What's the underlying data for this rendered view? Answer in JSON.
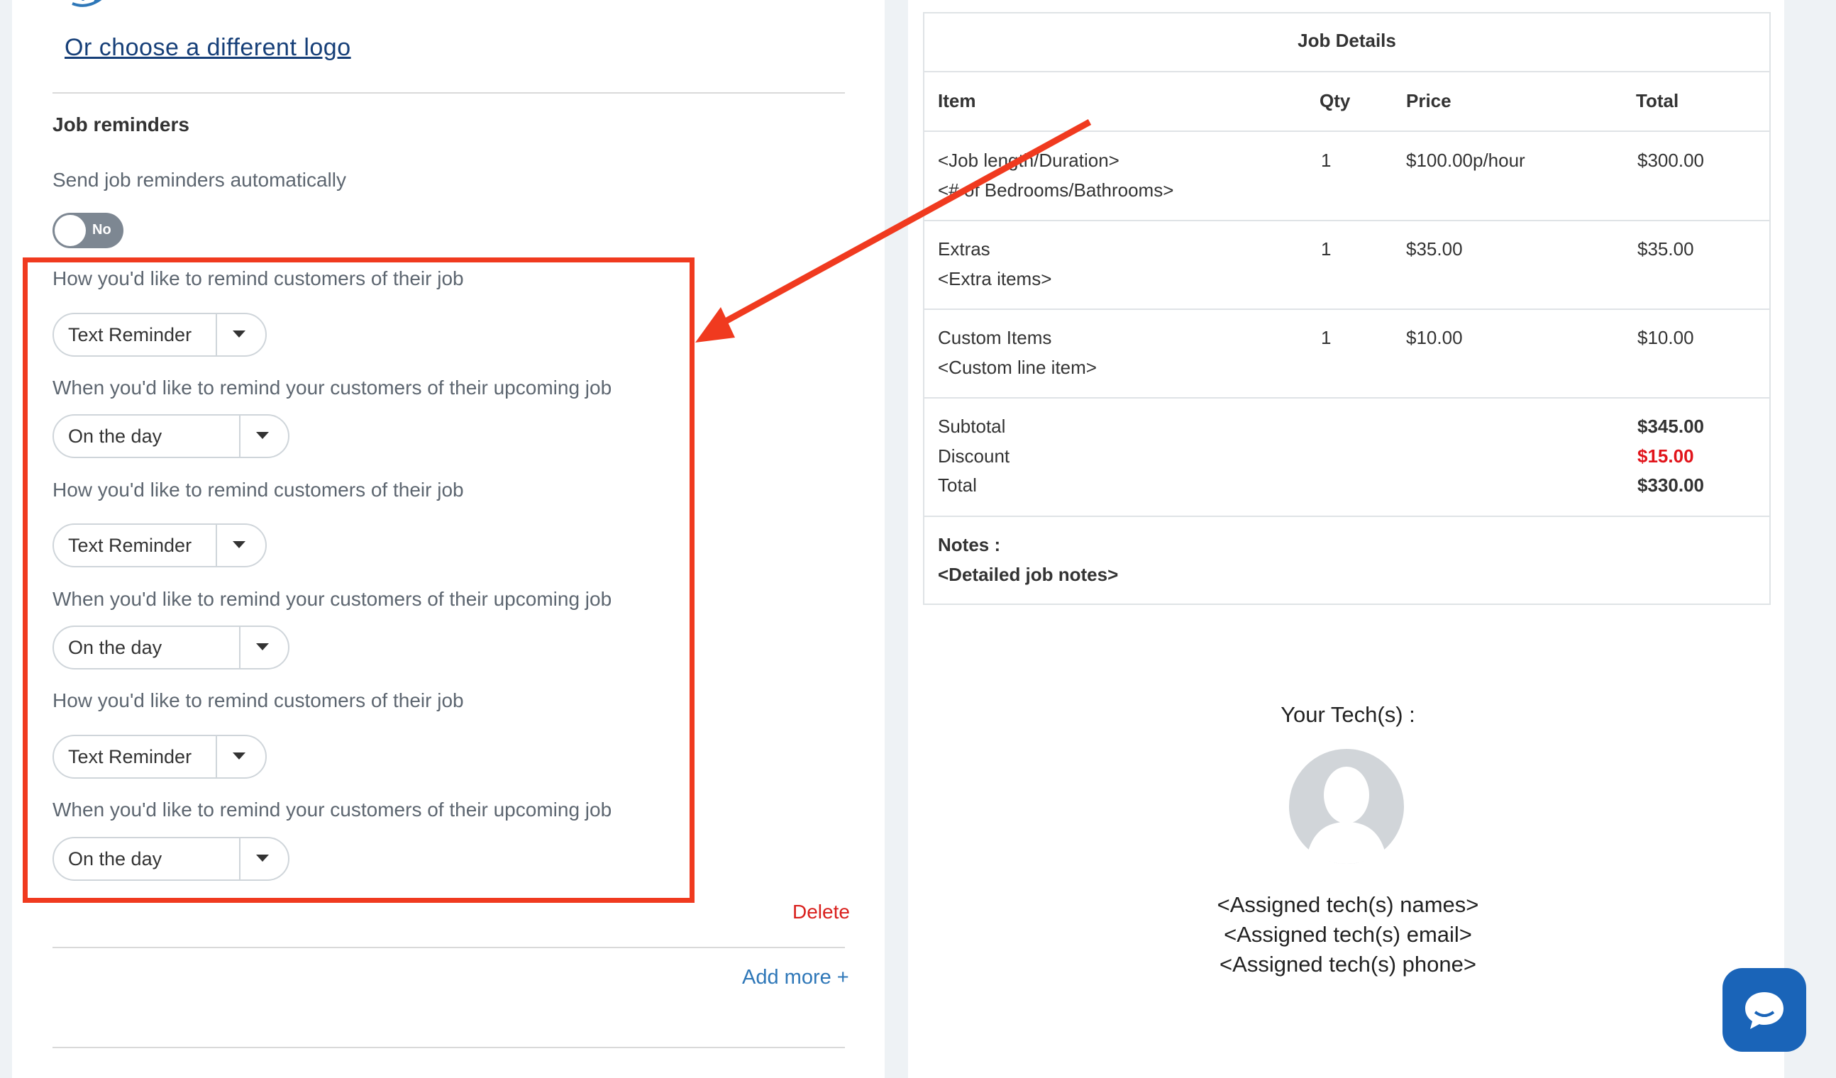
{
  "left": {
    "logo_link": "Or choose a different logo",
    "section_title": "Job reminders",
    "auto_label": "Send job reminders automatically",
    "toggle_label": "No",
    "reminders": [
      {
        "how_label": "How you'd like to remind customers of their job",
        "how_value": "Text Reminder",
        "when_label": "When you'd like to remind your customers of their upcoming job",
        "when_value": "On the day"
      },
      {
        "how_label": "How you'd like to remind customers of their job",
        "how_value": "Text Reminder",
        "when_label": "When you'd like to remind your customers of their upcoming job",
        "when_value": "On the day"
      },
      {
        "how_label": "How you'd like to remind customers of their job",
        "how_value": "Text Reminder",
        "when_label": "When you'd like to remind your customers of their upcoming job",
        "when_value": "On the day"
      }
    ],
    "delete_label": "Delete",
    "add_more_label": "Add more +"
  },
  "job_details": {
    "title": "Job Details",
    "headers": {
      "item": "Item",
      "qty": "Qty",
      "price": "Price",
      "total": "Total"
    },
    "rows": [
      {
        "line1": "<Job length/Duration>",
        "line2": "<# of Bedrooms/Bathrooms>",
        "qty": "1",
        "price": "$100.00p/hour",
        "total": "$300.00"
      },
      {
        "line1": "Extras",
        "line2": "<Extra items>",
        "qty": "1",
        "price": "$35.00",
        "total": "$35.00"
      },
      {
        "line1": "Custom Items",
        "line2": "<Custom line item>",
        "qty": "1",
        "price": "$10.00",
        "total": "$10.00"
      }
    ],
    "summary": {
      "subtotal_label": "Subtotal",
      "subtotal_value": "$345.00",
      "discount_label": "Discount",
      "discount_value": "$15.00",
      "total_label": "Total",
      "total_value": "$330.00"
    },
    "notes_label": "Notes :",
    "notes_value": "<Detailed job notes>"
  },
  "techs": {
    "title": "Your Tech(s) :",
    "names": "<Assigned tech(s) names>",
    "email": "<Assigned tech(s) email>",
    "phone": "<Assigned tech(s) phone>"
  },
  "colors": {
    "highlight": "#f03a1f",
    "link_dark": "#163f78",
    "link_blue": "#2e77b8",
    "danger": "#e1141b",
    "chat": "#1a64b8"
  },
  "icons": [
    "logo-mark-icon",
    "chevron-down-icon",
    "avatar-icon",
    "chat-icon"
  ]
}
